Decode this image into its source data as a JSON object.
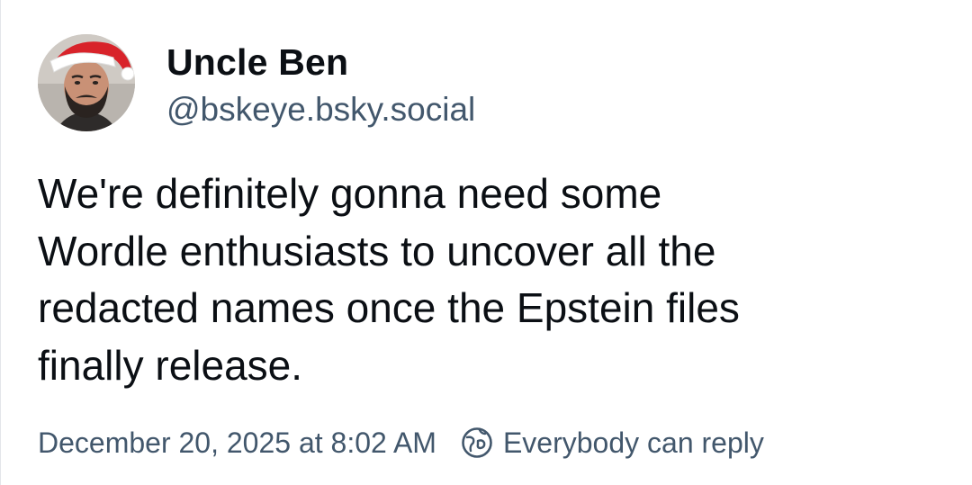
{
  "post": {
    "author": {
      "display_name": "Uncle Ben",
      "handle": "@bskeye.bsky.social",
      "avatar_icon": "avatar-santa-hat"
    },
    "text": "We're definitely gonna need some\nWordle enthusiasts to uncover all the\nredacted names once the Epstein files\nfinally release.",
    "timestamp": "December 20, 2025 at 8:02 AM",
    "reply_setting": {
      "icon": "globe-icon",
      "label": "Everybody can reply"
    }
  },
  "colors": {
    "text_primary": "#0b0f14",
    "text_secondary": "#42576c",
    "background": "#ffffff"
  }
}
